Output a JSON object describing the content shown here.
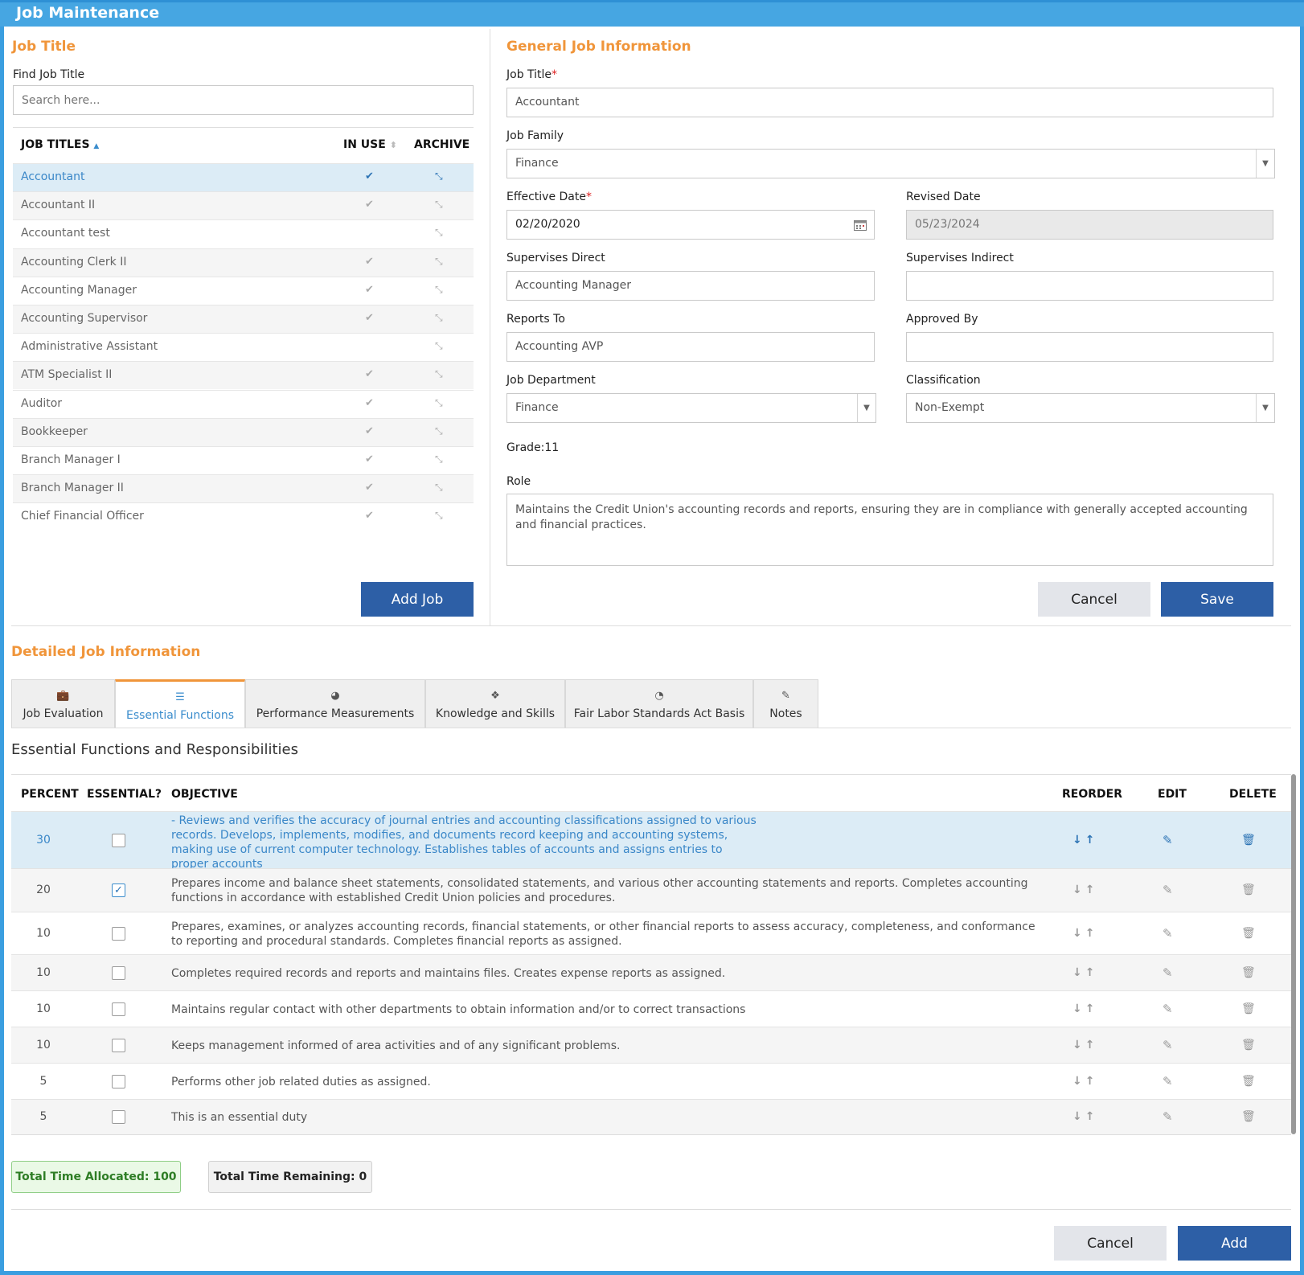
{
  "window": {
    "title": "Job Maintenance"
  },
  "left": {
    "section_title": "Job Title",
    "find_label": "Find Job Title",
    "search_placeholder": "Search here...",
    "columns": {
      "titles": "JOB TITLES",
      "titles_sort": "▲",
      "in_use": "IN USE",
      "in_use_sort": "⬍",
      "archive": "ARCHIVE"
    },
    "jobs": [
      {
        "name": "Accountant",
        "in_use": true,
        "selected": true
      },
      {
        "name": "Accountant II",
        "in_use": true
      },
      {
        "name": "Accountant test",
        "in_use": false
      },
      {
        "name": "Accounting Clerk II",
        "in_use": true
      },
      {
        "name": "Accounting Manager",
        "in_use": true
      },
      {
        "name": "Accounting Supervisor",
        "in_use": true
      },
      {
        "name": "Administrative Assistant",
        "in_use": false
      },
      {
        "name": "ATM Specialist II",
        "in_use": true
      },
      {
        "name": "Auditor",
        "in_use": true
      },
      {
        "name": "Bookkeeper",
        "in_use": true
      },
      {
        "name": "Branch Manager I",
        "in_use": true
      },
      {
        "name": "Branch Manager II",
        "in_use": true
      },
      {
        "name": "Chief Financial Officer",
        "in_use": true
      }
    ],
    "add_job_label": "Add Job"
  },
  "general": {
    "section_title": "General Job Information",
    "job_title_label": "Job Title",
    "job_title_value": "Accountant",
    "job_family_label": "Job Family",
    "job_family_value": "Finance",
    "effective_date_label": "Effective Date",
    "effective_date_value": "02/20/2020",
    "revised_date_label": "Revised Date",
    "revised_date_value": "05/23/2024",
    "supervises_direct_label": "Supervises Direct",
    "supervises_direct_value": "Accounting Manager",
    "supervises_indirect_label": "Supervises Indirect",
    "supervises_indirect_value": "",
    "reports_to_label": "Reports To",
    "reports_to_value": "Accounting AVP",
    "approved_by_label": "Approved By",
    "approved_by_value": "",
    "job_department_label": "Job Department",
    "job_department_value": "Finance",
    "classification_label": "Classification",
    "classification_value": "Non-Exempt",
    "grade_text": "Grade:11",
    "role_label": "Role",
    "role_value": "Maintains the Credit Union's accounting records and reports, ensuring they are in compliance with generally accepted accounting and financial practices.",
    "required_mark": "*",
    "cancel_label": "Cancel",
    "save_label": "Save"
  },
  "detail": {
    "section_title": "Detailed Job Information",
    "tabs": [
      {
        "label": "Job Evaluation",
        "icon": "briefcase-icon"
      },
      {
        "label": "Essential Functions",
        "icon": "list-icon",
        "active": true
      },
      {
        "label": "Performance Measurements",
        "icon": "dashboard-icon"
      },
      {
        "label": "Knowledge and Skills",
        "icon": "cubes-icon"
      },
      {
        "label": "Fair Labor Standards Act Basis",
        "icon": "pie-chart-icon"
      },
      {
        "label": "Notes",
        "icon": "edit-icon"
      }
    ],
    "functions_title": "Essential Functions and Responsibilities",
    "columns": {
      "percent": "PERCENT",
      "essential": "ESSENTIAL?",
      "objective": "OBJECTIVE",
      "reorder": "REORDER",
      "edit": "EDIT",
      "delete": "DELETE"
    },
    "functions": [
      {
        "percent": "30",
        "essential": false,
        "selected": true,
        "objective": "- Reviews and verifies the accuracy of journal entries and accounting classifications assigned to various records. Develops, implements, modifies, and documents record keeping and accounting systems, making use of current computer technology. Establishes tables of accounts and assigns entries to proper accounts"
      },
      {
        "percent": "20",
        "essential": true,
        "objective": "Prepares income and balance sheet statements, consolidated statements, and various other accounting statements and reports. Completes accounting functions in accordance with established Credit Union policies and procedures."
      },
      {
        "percent": "10",
        "essential": false,
        "objective": "Prepares, examines, or analyzes accounting records, financial statements, or other financial reports to assess accuracy, completeness, and conformance to reporting and procedural standards. Completes financial reports as assigned."
      },
      {
        "percent": "10",
        "essential": false,
        "objective": "Completes required records and reports and maintains files. Creates expense reports as assigned."
      },
      {
        "percent": "10",
        "essential": false,
        "objective": "Maintains regular contact with other departments to obtain information and/or to correct transactions"
      },
      {
        "percent": "10",
        "essential": false,
        "objective": "Keeps management informed of area activities and of any significant problems."
      },
      {
        "percent": "5",
        "essential": false,
        "objective": "Performs other job related duties as assigned."
      },
      {
        "percent": "5",
        "essential": false,
        "objective": "This is an essential duty"
      }
    ],
    "total_allocated": "Total Time Allocated: 100",
    "total_remaining": "Total Time Remaining: 0",
    "cancel_label": "Cancel",
    "add_label": "Add"
  }
}
